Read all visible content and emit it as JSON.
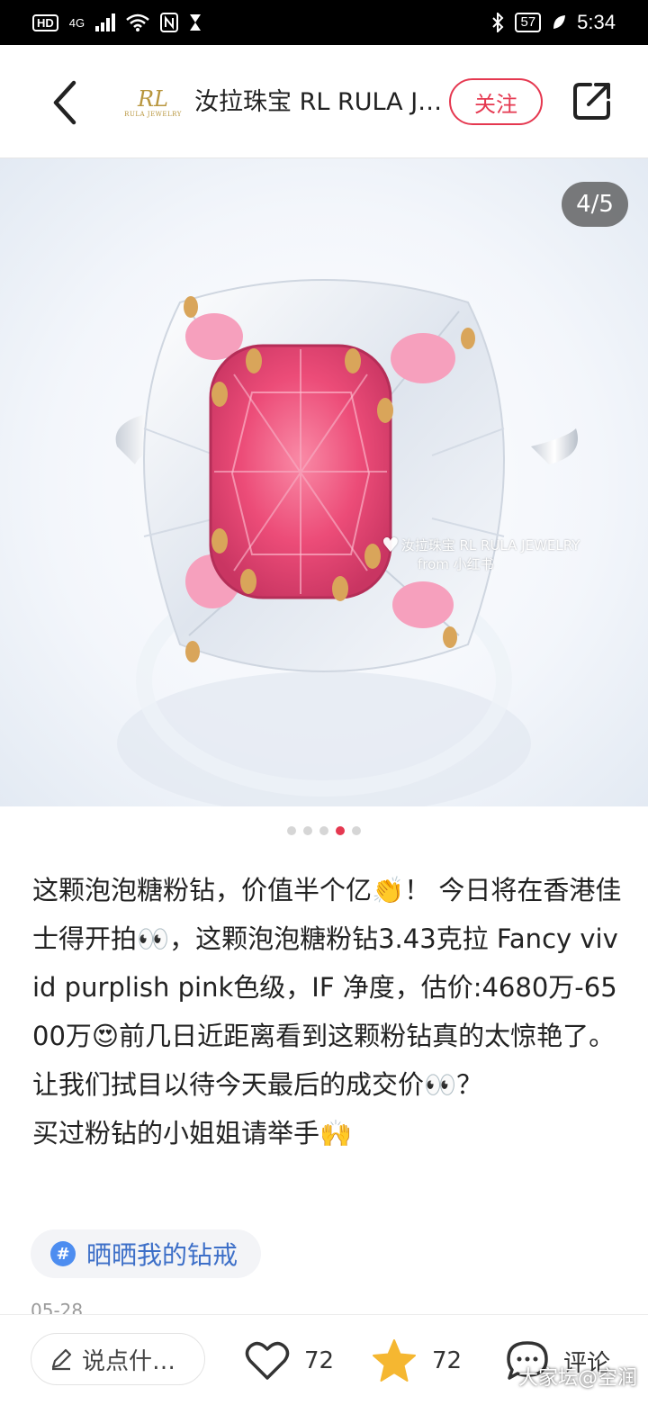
{
  "status_bar": {
    "hd": "HD",
    "network": "4G",
    "battery": "57",
    "time": "5:34"
  },
  "header": {
    "logo_text": "RL",
    "logo_subtext": "RULA JEWELRY",
    "brand_name": "汝拉珠宝 RL RULA J…",
    "follow_label": "关注"
  },
  "gallery": {
    "counter": "4/5",
    "total": 5,
    "active_index": 4,
    "watermark_line1": "汝拉珠宝 RL RULA JEWELRY",
    "watermark_line2": "from 小红书"
  },
  "post": {
    "lines": [
      "这颗泡泡糖粉钻，价值半个亿👏！ 今日将在香港佳士得开拍👀，这颗泡泡糖粉钻3.43克拉 Fancy vivid purplish pink色级，IF 净度，估价:4680万-6500万😍前几日近距离看到这颗粉钻真的太惊艳了。",
      "让我们拭目以待今天最后的成交价👀？",
      "买过粉钻的小姐姐请举手🙌"
    ],
    "tag": "晒晒我的钻戒",
    "tag_symbol": "#",
    "date": "05-28"
  },
  "bottom_bar": {
    "comment_placeholder": "说点什…",
    "likes": "72",
    "favorites": "72",
    "comment_label": "评论",
    "site_mark": "大家坛@空润"
  },
  "colors": {
    "accent": "#e53850",
    "tag_blue": "#3d6fc8",
    "star_yellow": "#f5b731",
    "diamond_pink": "#ef5a84"
  }
}
